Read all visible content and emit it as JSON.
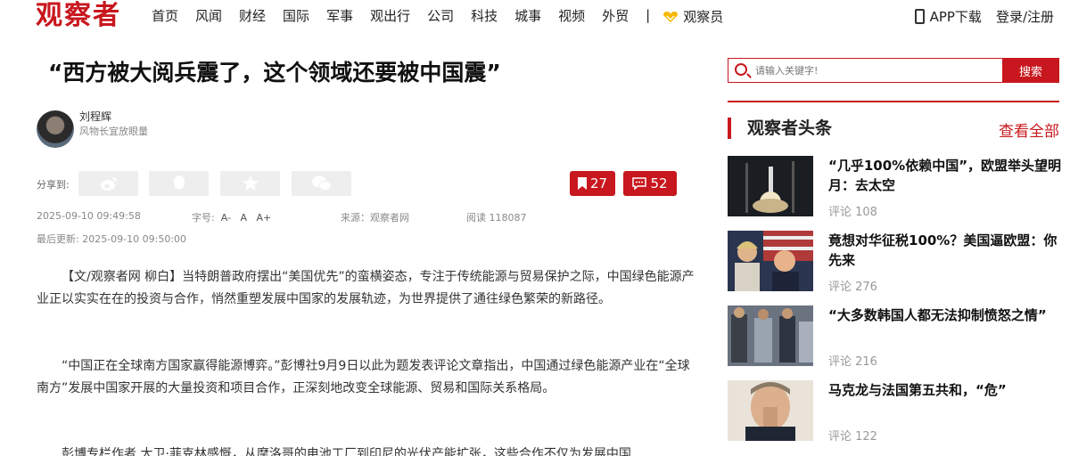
{
  "header": {
    "logo": "观察者",
    "nav": [
      "首页",
      "风闻",
      "财经",
      "国际",
      "军事",
      "观出行",
      "公司",
      "科技",
      "城事",
      "视频",
      "外贸"
    ],
    "separator": "|",
    "guanchazhe": "观察员",
    "app_download": "APP下载",
    "login": "登录/注册"
  },
  "article": {
    "title": "“西方被大阅兵震了，这个领域还要被中国震”",
    "author_name": "刘程辉",
    "author_desc": "风物长宜放眼量",
    "share_label": "分享到:",
    "bookmark_count": "27",
    "comment_count": "52",
    "date": "2025-09-10 09:49:58",
    "font_label": "字号:",
    "font_small": "A-",
    "font_normal": "A",
    "font_large": "A+",
    "source": "来源：观察者网",
    "reads": "阅读 118087",
    "updated": "最后更新: 2025-09-10 09:50:00",
    "paragraphs": [
      "【文/观察者网 柳白】当特朗普政府摆出“美国优先”的蛮横姿态，专注于传统能源与贸易保护之际，中国绿色能源产业正以实实在在的投资与合作，悄然重塑发展中国家的发展轨迹，为世界提供了通往绿色繁荣的新路径。",
      "“中国正在全球南方国家赢得能源博弈。”彭博社9月9日以此为题发表评论文章指出，中国通过绿色能源产业在“全球南方”发展中国家开展的大量投资和项目合作，正深刻地改变全球能源、贸易和国际关系格局。",
      "彭博专栏作者 大卫·菲克林感慨，从摩洛哥的电池工厂到印尼的光伏产能扩张，这些合作不仅为发展中国"
    ]
  },
  "sidebar": {
    "search_placeholder": "请输入关键字!",
    "search_button": "搜索",
    "section_title": "观察者头条",
    "more": "查看全部",
    "items": [
      {
        "title": "“几乎100%依赖中国”，欧盟举头望明月：去太空",
        "comments": "评论 108"
      },
      {
        "title": "竟想对华征税100%？美国逼欧盟：你先来",
        "comments": "评论 276"
      },
      {
        "title": "“大多数韩国人都无法抑制愤怒之情”",
        "comments": "评论 216"
      },
      {
        "title": "马克龙与法国第五共和，“危”",
        "comments": "评论 122"
      }
    ]
  },
  "colors": {
    "brand": "#c8171e"
  }
}
